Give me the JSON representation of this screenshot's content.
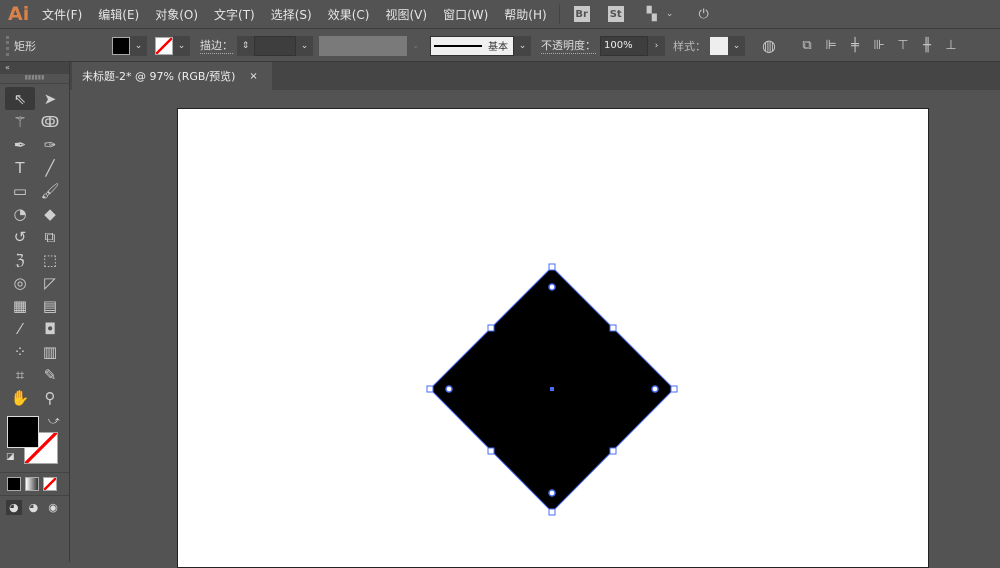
{
  "app": {
    "logo": "Ai"
  },
  "menu": [
    "文件(F)",
    "编辑(E)",
    "对象(O)",
    "文字(T)",
    "选择(S)",
    "效果(C)",
    "视图(V)",
    "窗口(W)",
    "帮助(H)"
  ],
  "menu_icons": {
    "bridge": "Br",
    "stock": "St"
  },
  "control": {
    "object_type": "矩形",
    "stroke_label": "描边：",
    "stroke_profile": "基本",
    "opacity_label": "不透明度：",
    "opacity_value": "100%",
    "style_label": "样式：",
    "fill_color": "#000000"
  },
  "document_tab": {
    "title": "未标题-2* @ 97% (RGB/预览)",
    "close": "×"
  },
  "toolbar": {
    "collapse": "«"
  },
  "colors": {
    "accent": "#4a6cf7",
    "logo": "#d7824a",
    "stroke_none": "#ff0000"
  },
  "artwork": {
    "shape": "rotated square",
    "fill": "#000000",
    "selected": true
  }
}
